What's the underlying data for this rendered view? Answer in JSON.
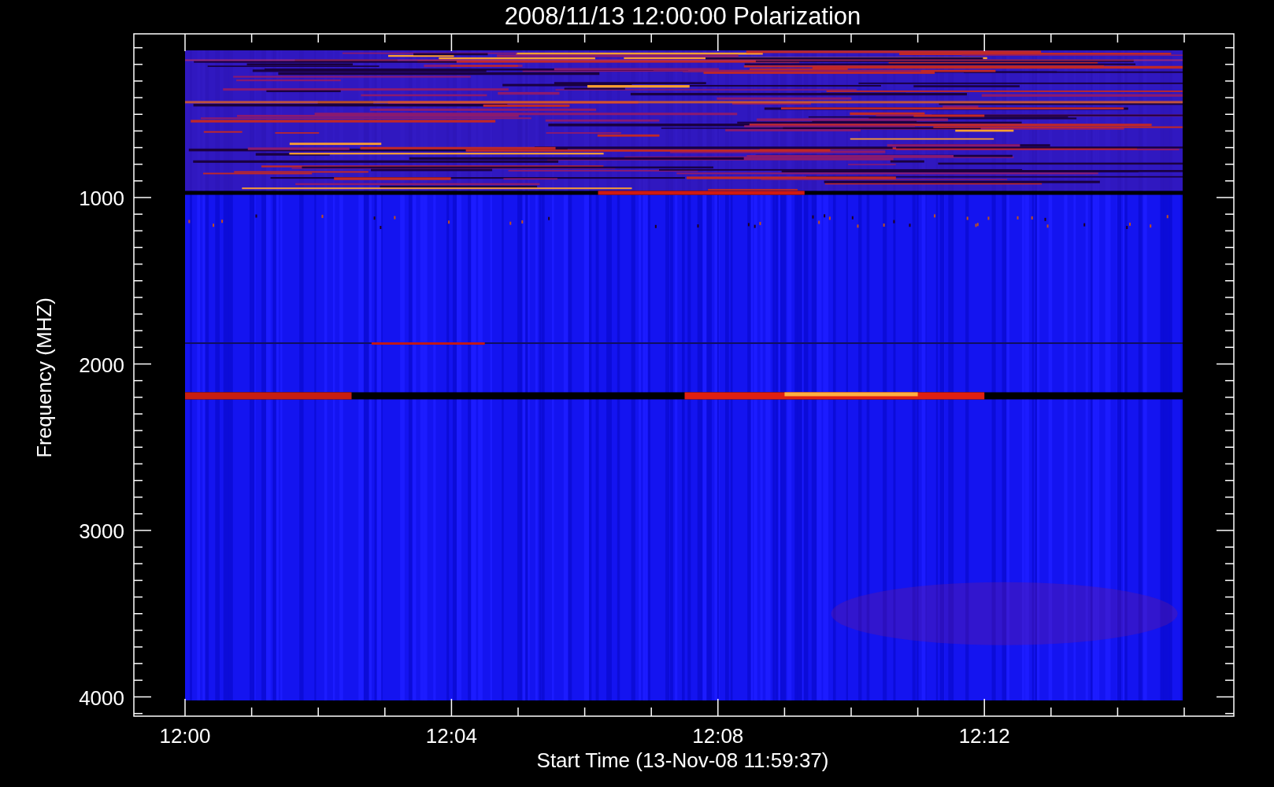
{
  "title": "2008/11/13 12:00:00 Polarization",
  "plot": {
    "xlabel": "Start Time (13-Nov-08 11:59:37)",
    "ylabel": "Frequency (MHZ)",
    "xtick_labels": [
      "12:00",
      "12:04",
      "12:08",
      "12:12"
    ],
    "ytick_labels": [
      "1000",
      "2000",
      "3000",
      "4000"
    ]
  }
}
